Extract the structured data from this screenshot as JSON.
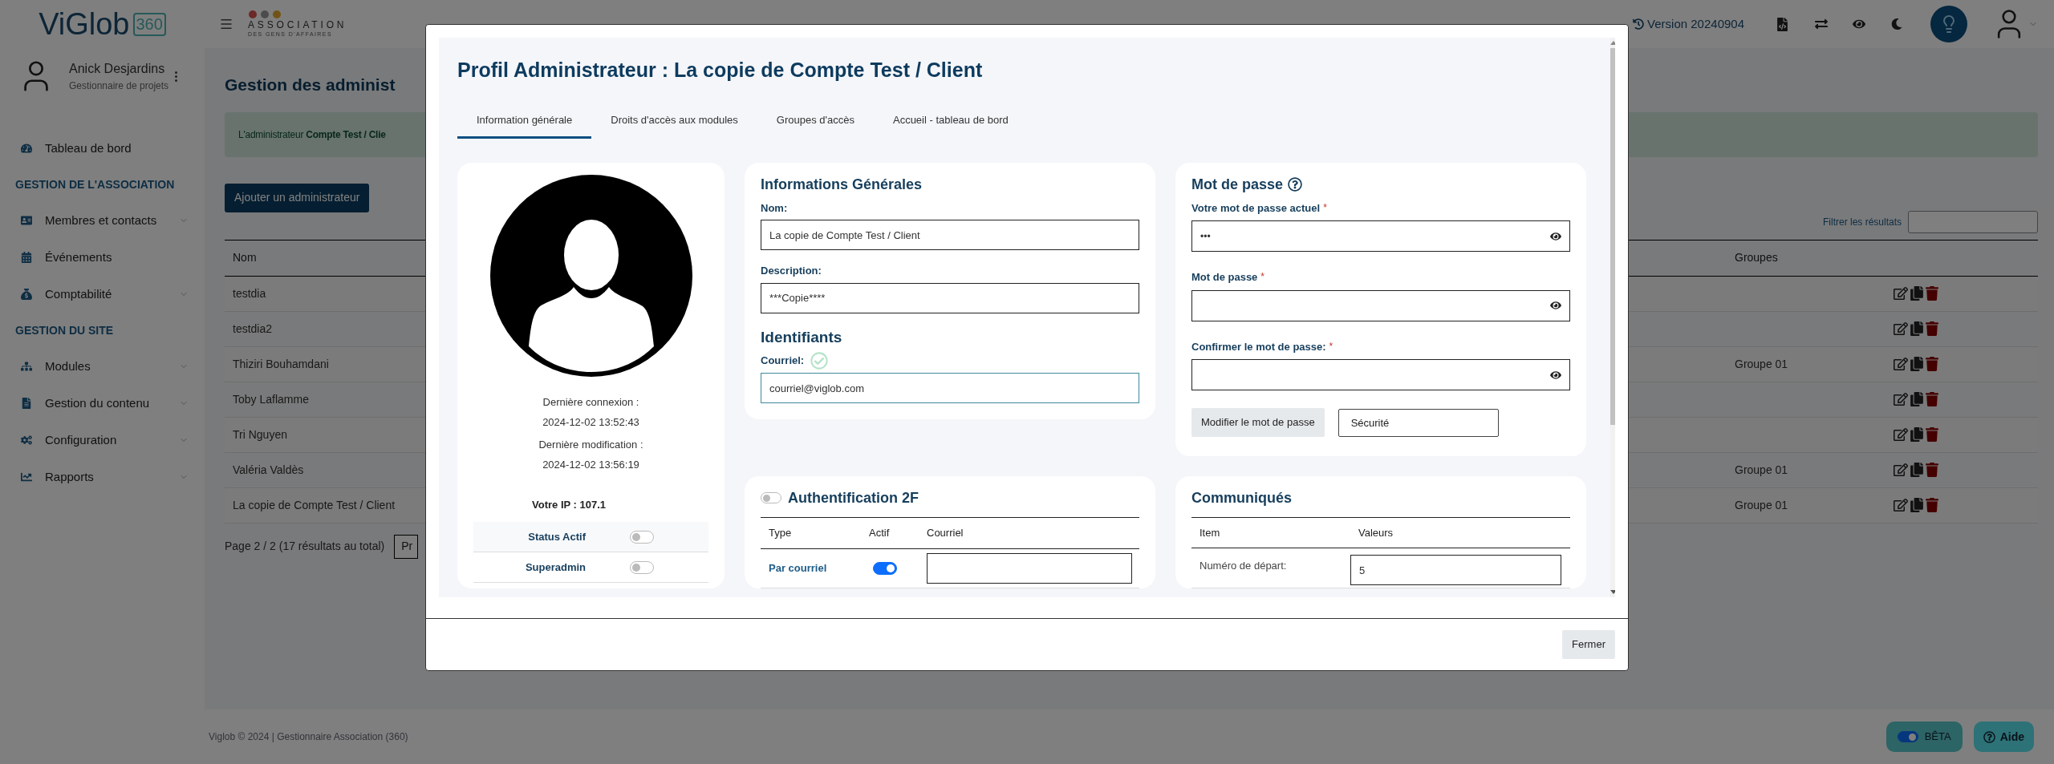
{
  "header": {
    "logo": "ViGlob",
    "logo_badge": "360",
    "org_name": "ASSOCIATION",
    "org_tagline": "DES GENS D'AFFAIRES",
    "version": "Version 20240904"
  },
  "user": {
    "name": "Anick Desjardins",
    "role": "Gestionnaire de projets"
  },
  "sidebar": {
    "items": [
      {
        "kind": "link",
        "label": "Tableau de bord",
        "expandable": false
      },
      {
        "kind": "heading",
        "label": "GESTION DE L'ASSOCIATION"
      },
      {
        "kind": "link",
        "label": "Membres et contacts",
        "expandable": true
      },
      {
        "kind": "link",
        "label": "Événements",
        "expandable": false
      },
      {
        "kind": "link",
        "label": "Comptabilité",
        "expandable": true
      },
      {
        "kind": "heading",
        "label": "GESTION DU SITE"
      },
      {
        "kind": "link",
        "label": "Modules",
        "expandable": true
      },
      {
        "kind": "link",
        "label": "Gestion du contenu",
        "expandable": true
      },
      {
        "kind": "link",
        "label": "Configuration",
        "expandable": true
      },
      {
        "kind": "link",
        "label": "Rapports",
        "expandable": true
      }
    ]
  },
  "page": {
    "title": "Gestion des administ",
    "alert": "L'administrateur **Compte Test / Clie**",
    "add_button": "Ajouter un administrateur",
    "filter_label": "Filtrer les résultats",
    "table": {
      "column_1": "Nom",
      "column_2": "Groupes",
      "rows": [
        {
          "nom": "testdia"
        },
        {
          "nom": "testdia2"
        },
        {
          "nom": "Thiziri Bouhamdani",
          "groupes": "Groupe 01"
        },
        {
          "nom": "Toby Laflamme"
        },
        {
          "nom": "Tri Nguyen"
        },
        {
          "nom": "Valéria Valdès",
          "groupes": "Groupe 01"
        },
        {
          "nom": "La copie de Compte Test / Client",
          "groupes": "Groupe 01"
        }
      ]
    },
    "pagination": "Page 2 / 2 (17 résultats au total)",
    "prev_button": "Pr"
  },
  "footer": "Viglob © 2024 | Gestionnaire Association (360)",
  "beta": {
    "label": "BÊTA",
    "on": true
  },
  "help_button": "Aide",
  "modal": {
    "title": "Profil Administrateur : La copie de Compte Test / Client",
    "tabs": [
      {
        "label": "Information générale",
        "selected": true
      },
      {
        "label": "Droits d'accès aux modules",
        "selected": false
      },
      {
        "label": "Groupes d'accès",
        "selected": false
      },
      {
        "label": "Accueil - tableau de bord",
        "selected": false
      }
    ],
    "profile": {
      "last_login_label": "Dernière connexion :",
      "last_login": "2024-12-02 13:52:43",
      "last_mod_label": "Dernière modification :",
      "last_mod": "2024-12-02 13:56:19",
      "ip": "Votre IP : 107.1",
      "flags": [
        {
          "label": "Status Actif",
          "on": false
        },
        {
          "label": "Superadmin",
          "on": false
        }
      ]
    },
    "general": {
      "title": "Informations Générales",
      "fields": [
        {
          "label": "Nom:",
          "value": "La copie de Compte Test / Client"
        },
        {
          "label": "Description:",
          "value": "***Copie****"
        }
      ],
      "ids_title": "Identifiants",
      "email": {
        "label": "Courriel:",
        "value": "courriel@viglob.com",
        "valid": true
      }
    },
    "two_factor": {
      "title": "Authentification 2F",
      "on": false,
      "columns": [
        "Type",
        "Actif",
        "Courriel"
      ],
      "rows": [
        {
          "type": "Par courriel",
          "on": true
        }
      ]
    },
    "password": {
      "title": "Mot de passe",
      "fields": [
        {
          "label": "Votre mot de passe actuel",
          "required_mark": "*",
          "value": "•••"
        },
        {
          "label": "Mot de passe",
          "required_mark": "*"
        },
        {
          "label": "Confirmer le mot de passe:",
          "required_mark": "*"
        }
      ],
      "submit": "Modifier le mot de passe",
      "strength": "Sécurité"
    },
    "releases": {
      "title": "Communiqués",
      "columns": [
        "Item",
        "Valeurs"
      ],
      "rows": [
        {
          "item": "Numéro de départ:",
          "value": "5"
        }
      ]
    },
    "close_button": "Fermer"
  }
}
